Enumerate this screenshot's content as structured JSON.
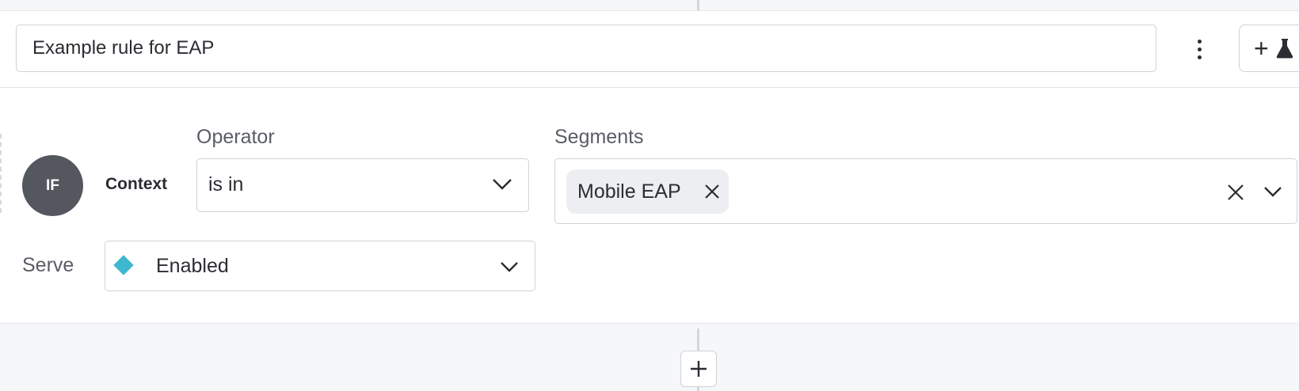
{
  "rule": {
    "name_value": "Example rule for EAP",
    "condition": {
      "badge": "IF",
      "context_label": "Context",
      "operator": {
        "label": "Operator",
        "value": "is in"
      },
      "segments": {
        "label": "Segments",
        "selected": [
          "Mobile EAP"
        ]
      }
    },
    "serve": {
      "label": "Serve",
      "value": "Enabled",
      "color": "#3fb8cf"
    }
  },
  "icons": {
    "more": "kebab-icon",
    "add": "plus-icon",
    "experiment": "flask-icon",
    "dropdown": "chevron-down-icon",
    "remove": "close-icon"
  }
}
